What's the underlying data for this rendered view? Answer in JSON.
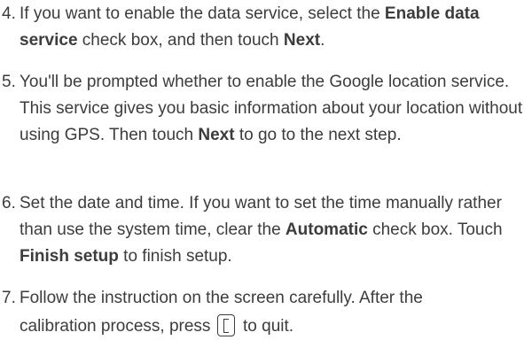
{
  "steps": [
    {
      "number": "4.",
      "parts": [
        "If you want to enable the data service, select the ",
        "Enable data service",
        " check box, and then touch ",
        "Next",
        "."
      ]
    },
    {
      "number": "5.",
      "parts": [
        "You'll be prompted whether to enable the Google location service. This service gives you basic information about your location without using GPS. Then touch ",
        "Next",
        " to go to the next step."
      ]
    },
    {
      "number": "6.",
      "parts": [
        "Set the date and time. If you want to set the time manually rather than use the system time, clear the ",
        "Automatic",
        " check box. Touch ",
        "Finish setup",
        " to finish setup."
      ]
    },
    {
      "number": "7.",
      "line1": "Follow the instruction on the screen carefully. After the",
      "line2_before": "calibration process, press ",
      "key_icon": "back-key-icon",
      "line2_after": " to quit."
    }
  ]
}
